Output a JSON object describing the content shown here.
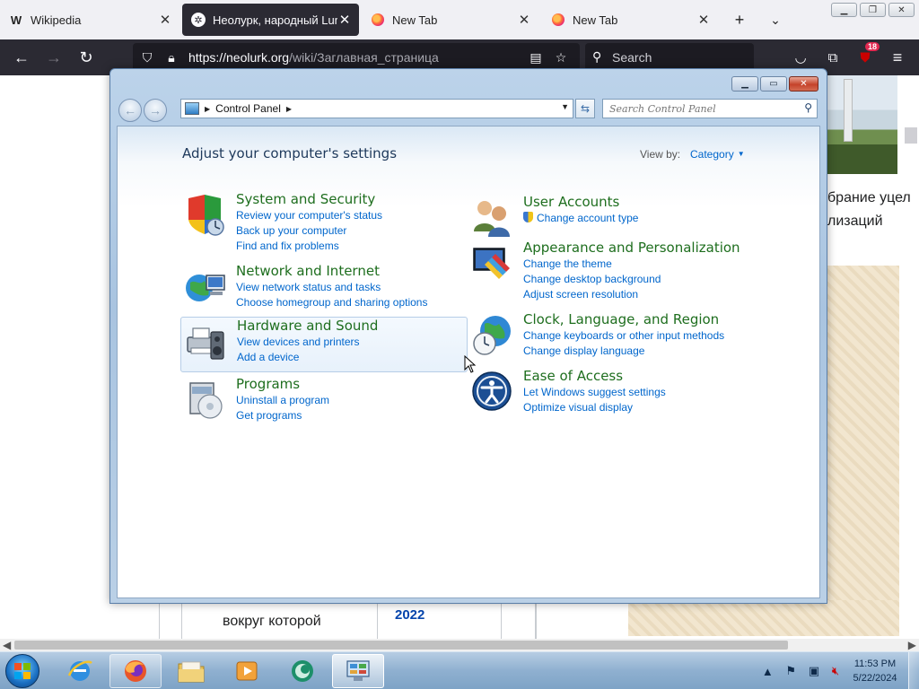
{
  "browser": {
    "tabs": [
      {
        "title": "Wikipedia",
        "favicon": "wikipedia-w-icon",
        "active": false
      },
      {
        "title": "Неолурк, народный Lurk",
        "favicon": "neolurk-icon",
        "active": true
      },
      {
        "title": "New Tab",
        "favicon": "firefox-icon",
        "active": false
      },
      {
        "title": "New Tab",
        "favicon": "firefox-icon",
        "active": false
      }
    ],
    "url_host": "https://neolurk.org",
    "url_path": "/wiki/Заглавная_страница",
    "search_placeholder": "Search",
    "extensions_badge": "18"
  },
  "webpage": {
    "text_right_1": "брание уцел",
    "text_right_2": "лизаций",
    "text_bottom_1": "вокруг которой",
    "text_bottom_2": "2022"
  },
  "control_panel": {
    "breadcrumb": "Control Panel",
    "search_placeholder": "Search Control Panel",
    "heading": "Adjust your computer's settings",
    "view_by_label": "View by:",
    "view_by_value": "Category",
    "categories": [
      {
        "title": "System and Security",
        "links": [
          "Review your computer's status",
          "Back up your computer",
          "Find and fix problems"
        ]
      },
      {
        "title": "Network and Internet",
        "links": [
          "View network status and tasks",
          "Choose homegroup and sharing options"
        ]
      },
      {
        "title": "Hardware and Sound",
        "links": [
          "View devices and printers",
          "Add a device"
        ]
      },
      {
        "title": "Programs",
        "links": [
          "Uninstall a program",
          "Get programs"
        ]
      },
      {
        "title": "User Accounts",
        "links": [
          "Change account type"
        ]
      },
      {
        "title": "Appearance and Personalization",
        "links": [
          "Change the theme",
          "Change desktop background",
          "Adjust screen resolution"
        ]
      },
      {
        "title": "Clock, Language, and Region",
        "links": [
          "Change keyboards or other input methods",
          "Change display language"
        ]
      },
      {
        "title": "Ease of Access",
        "links": [
          "Let Windows suggest settings",
          "Optimize visual display"
        ]
      }
    ]
  },
  "taskbar": {
    "apps": [
      "internet-explorer",
      "firefox",
      "windows-explorer",
      "media-player",
      "unknown-green-app",
      "control-panel"
    ],
    "clock_time": "11:53 PM",
    "clock_date": "5/22/2024"
  },
  "colors": {
    "category_title": "#1e6e1e",
    "link": "#0066cc",
    "browser_dark": "#2b2a33"
  }
}
